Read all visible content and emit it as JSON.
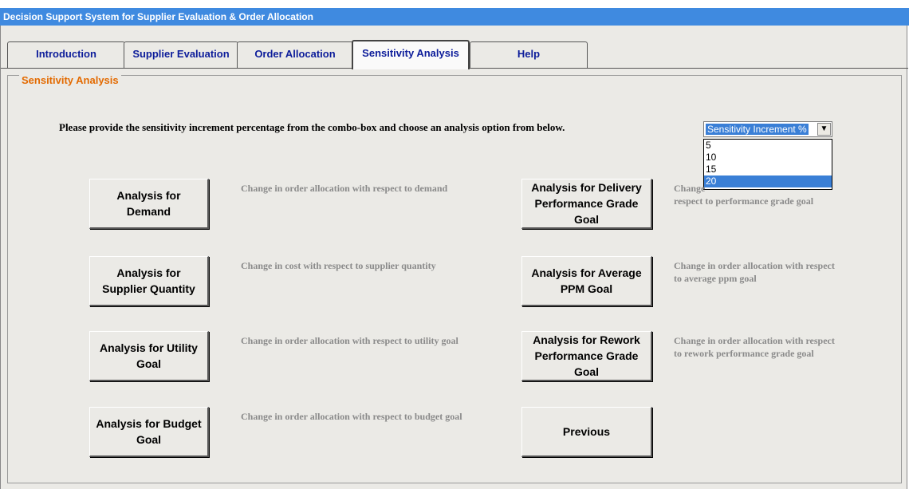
{
  "window": {
    "title": "Decision Support System for Supplier Evaluation & Order Allocation"
  },
  "tabs": [
    {
      "label": "Introduction"
    },
    {
      "label": "Supplier Evaluation"
    },
    {
      "label": "Order Allocation"
    },
    {
      "label": "Sensitivity Analysis",
      "active": true
    },
    {
      "label": "Help"
    }
  ],
  "panel": {
    "legend": "Sensitivity Analysis",
    "instruction": "Please provide the sensitivity increment percentage from the combo-box and choose an analysis option from below."
  },
  "combo": {
    "value": "Sensitivity Increment %",
    "options": [
      "5",
      "10",
      "15",
      "20"
    ],
    "selected": "20"
  },
  "buttons": {
    "demand": "Analysis for Demand",
    "supplier_quantity": "Analysis for Supplier Quantity",
    "utility_goal": "Analysis for Utility Goal",
    "budget_goal": "Analysis for Budget Goal",
    "delivery_goal": "Analysis for Delivery Performance Grade Goal",
    "ppm_goal": "Analysis for Average PPM Goal",
    "rework_goal": "Analysis for Rework Performance Grade Goal",
    "previous": "Previous"
  },
  "descriptions": {
    "demand": "Change in order allocation with respect to demand",
    "supplier_quantity": "Change in cost with respect to supplier quantity",
    "utility_goal": "Change in order allocation with respect to utility goal",
    "budget_goal": "Change in order allocation with respect to budget goal",
    "delivery_goal_visible": "Change",
    "delivery_goal_rest": "respect to performance grade goal",
    "ppm_goal": "Change in order allocation with respect to average ppm goal",
    "rework_goal": "Change in order allocation with respect to rework performance grade goal"
  },
  "colors": {
    "titlebar": "#3f8ae0",
    "tab_text": "#0c1c9a",
    "legend": "#e36a00",
    "selection": "#3a7fd6"
  }
}
